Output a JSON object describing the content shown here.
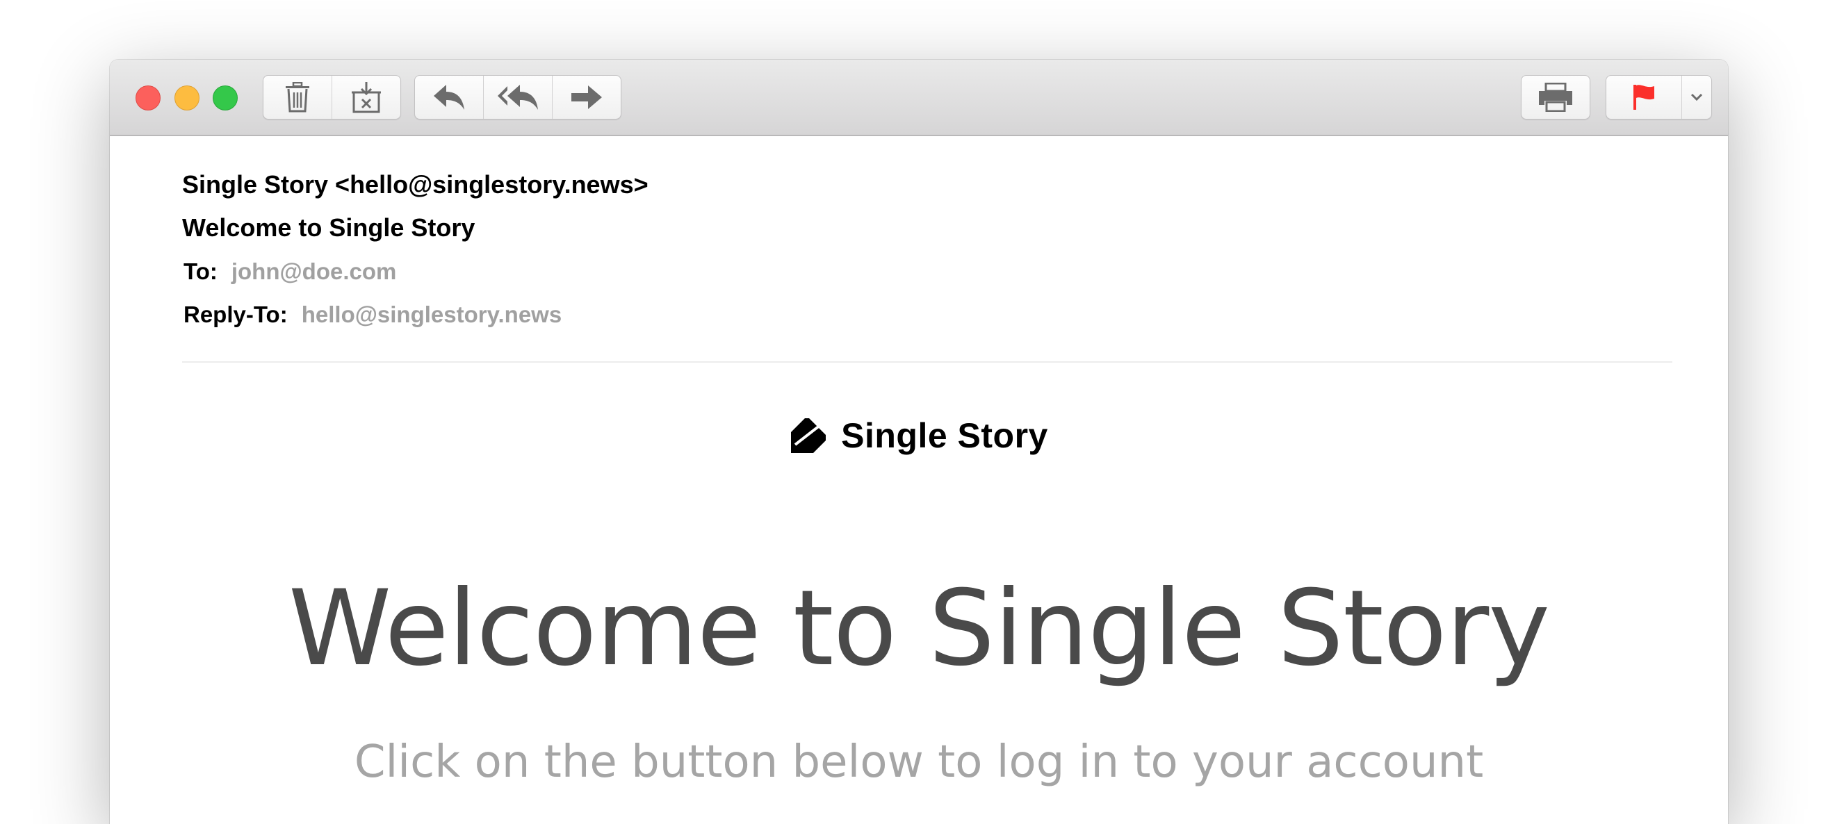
{
  "toolbar": {
    "buttons": [
      "trash-icon",
      "junk-icon",
      "reply-icon",
      "reply-all-icon",
      "forward-icon",
      "print-icon",
      "flag-icon",
      "chevron-down-icon"
    ],
    "flag_color": "#fb2f2b"
  },
  "message": {
    "from": "Single Story <hello@singlestory.news>",
    "subject": "Welcome to Single Story",
    "to_label": "To:",
    "to_value": "john@doe.com",
    "reply_to_label": "Reply-To:",
    "reply_to_value": "hello@singlestory.news"
  },
  "body": {
    "brand_name": "Single Story",
    "heading": "Welcome to Single Story",
    "subheading": "Click on the button below to log in to your account"
  }
}
